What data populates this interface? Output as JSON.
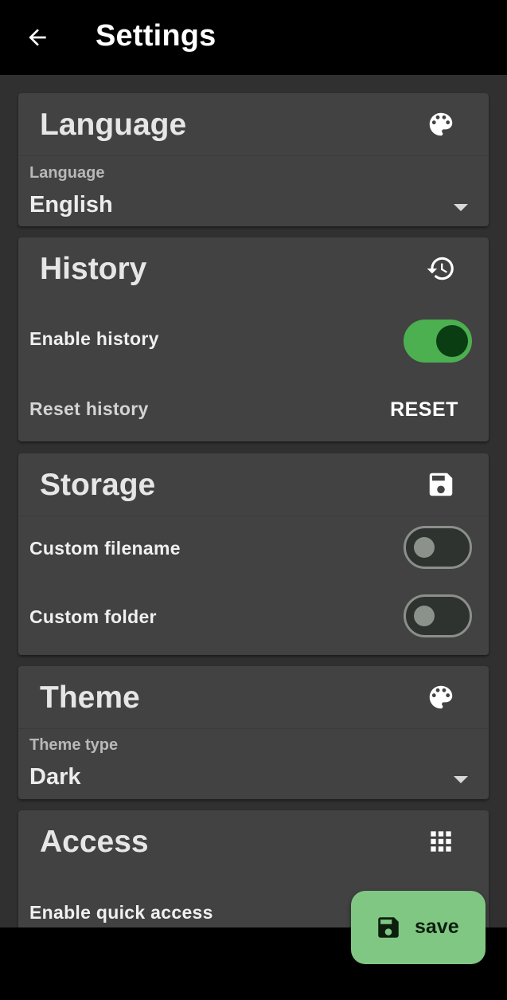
{
  "appbar": {
    "title": "Settings",
    "back_icon": "arrow-left-icon"
  },
  "cards": {
    "language": {
      "title": "Language",
      "icon": "palette-icon",
      "field_label": "Language",
      "field_value": "English"
    },
    "history": {
      "title": "History",
      "icon": "history-icon",
      "enable_label": "Enable history",
      "enable_on": true,
      "reset_label": "Reset history",
      "reset_button": "RESET"
    },
    "storage": {
      "title": "Storage",
      "icon": "floppy-disk-icon",
      "custom_filename_label": "Custom filename",
      "custom_filename_on": false,
      "custom_folder_label": "Custom folder",
      "custom_folder_on": false
    },
    "theme": {
      "title": "Theme",
      "icon": "palette-icon",
      "field_label": "Theme type",
      "field_value": "Dark"
    },
    "access": {
      "title": "Access",
      "icon": "grid-icon",
      "quick_access_label": "Enable quick access"
    }
  },
  "fab": {
    "label": "save",
    "icon": "floppy-disk-icon"
  },
  "colors": {
    "background": "#303030",
    "card": "#424242",
    "switch_on": "#4caf50",
    "fab": "#81c784"
  }
}
